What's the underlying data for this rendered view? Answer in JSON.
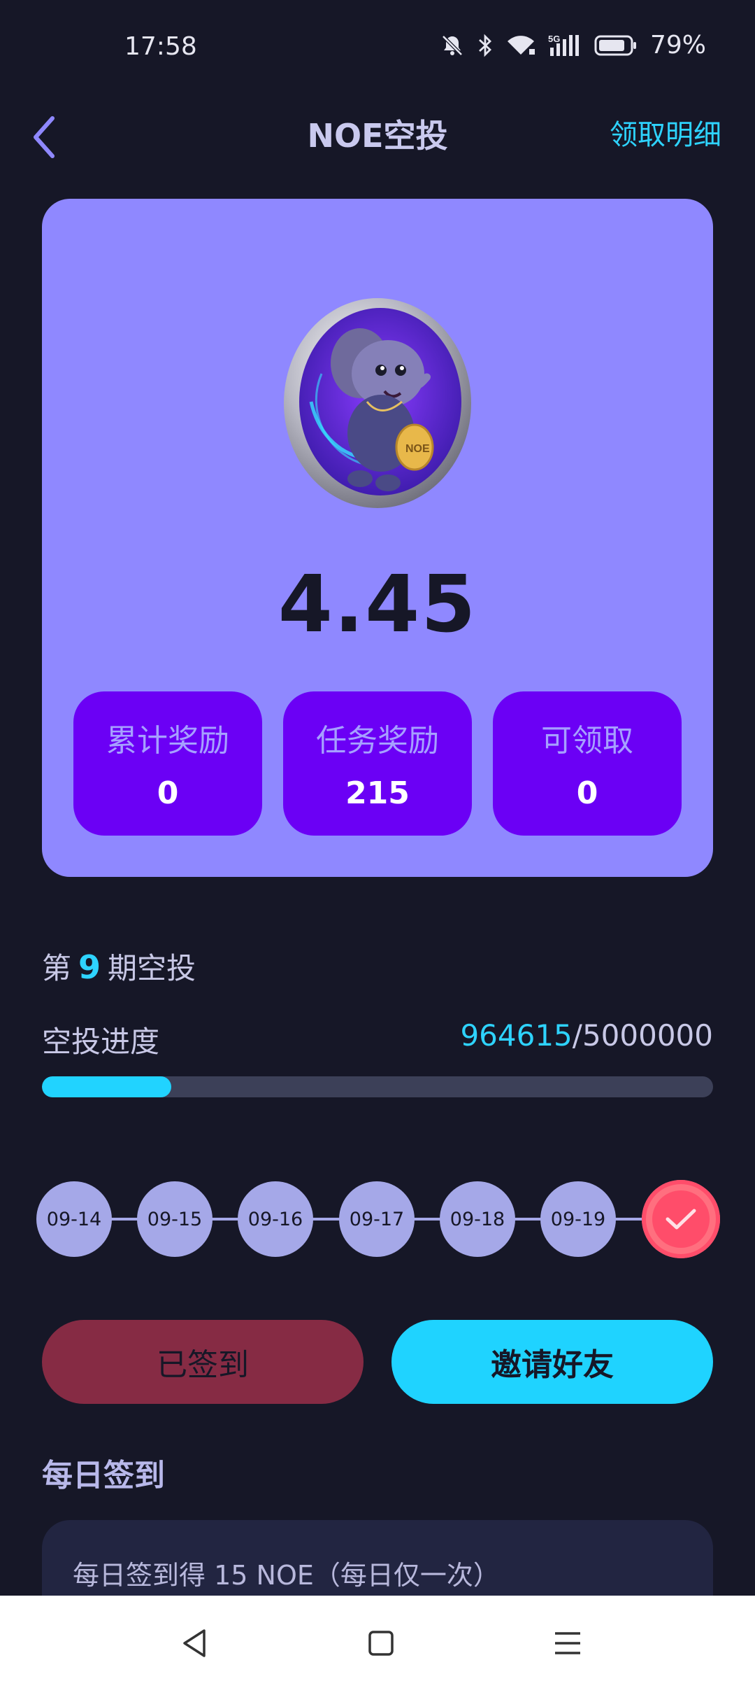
{
  "status_bar": {
    "time": "17:58",
    "battery_percent": "79%",
    "icons": [
      "mute-icon",
      "bluetooth-icon",
      "wifi-icon",
      "signal-5g-icon",
      "battery-icon"
    ]
  },
  "header": {
    "title": "NOE空投",
    "detail_link": "领取明细"
  },
  "card": {
    "balance": "4.45",
    "stats": [
      {
        "label": "累计奖励",
        "value": "0"
      },
      {
        "label": "任务奖励",
        "value": "215"
      },
      {
        "label": "可领取",
        "value": "0"
      }
    ]
  },
  "period": {
    "prefix": "第",
    "number": "9",
    "suffix": "期空投"
  },
  "progress": {
    "label": "空投进度",
    "current": "964615",
    "separator": "/",
    "total": "5000000",
    "fraction": 0.193
  },
  "timeline": {
    "dates": [
      "09-14",
      "09-15",
      "09-16",
      "09-17",
      "09-18",
      "09-19"
    ],
    "today_checked": true
  },
  "buttons": {
    "signed": "已签到",
    "invite": "邀请好友"
  },
  "daily": {
    "title": "每日签到",
    "task_text": "每日签到得 15 NOE（每日仅一次）"
  },
  "colors": {
    "background": "#161727",
    "card": "#8f88ff",
    "stat_box": "#6b00f5",
    "accent": "#21d3ff",
    "signed_button": "#862b44",
    "check": "#ff4d6a"
  }
}
